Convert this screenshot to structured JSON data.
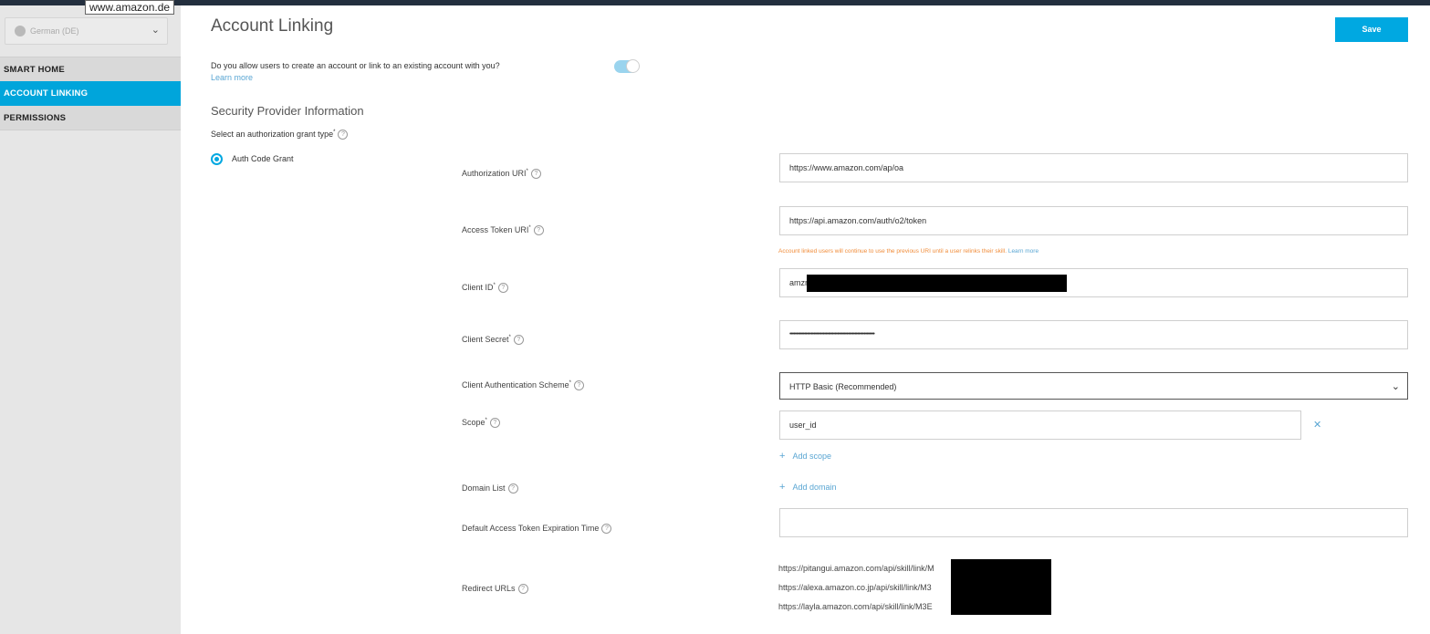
{
  "tooltip": "www.amazon.de",
  "sidebar": {
    "locale": "German (DE)",
    "items": [
      {
        "label": "SMART HOME"
      },
      {
        "label": "ACCOUNT LINKING"
      },
      {
        "label": "PERMISSIONS"
      }
    ]
  },
  "page": {
    "title": "Account Linking",
    "save_label": "Save",
    "question": "Do you allow users to create an account or link to an existing account with you?",
    "learn_more": "Learn more",
    "toggle_on": true,
    "section_title": "Security Provider Information",
    "grant_type_label": "Select an authorization grant type",
    "grant_option": "Auth Code Grant"
  },
  "form": {
    "authorization_uri": {
      "label": "Authorization URI",
      "value": "https://www.amazon.com/ap/oa"
    },
    "access_token_uri": {
      "label": "Access Token URI",
      "value": "https://api.amazon.com/auth/o2/token"
    },
    "access_note": "Account linked users will continue to use the previous URI until a user relinks their skill.",
    "access_note_link": "Learn more",
    "client_id": {
      "label": "Client ID",
      "value": "amzn"
    },
    "client_secret": {
      "label": "Client Secret",
      "value": "••••••••••••••••••••••••••••••••••••••••••••••••••••••••••••••••"
    },
    "client_auth_scheme": {
      "label": "Client Authentication Scheme",
      "value": "HTTP Basic (Recommended)"
    },
    "scope": {
      "label": "Scope",
      "value": "user_id"
    },
    "add_scope": "Add scope",
    "domain_list": {
      "label": "Domain List"
    },
    "add_domain": "Add domain",
    "expiration": {
      "label": "Default Access Token Expiration Time",
      "value": ""
    },
    "redirect": {
      "label": "Redirect URLs",
      "urls": [
        "https://pitangui.amazon.com/api/skill/link/M",
        "https://alexa.amazon.co.jp/api/skill/link/M3",
        "https://layla.amazon.com/api/skill/link/M3E"
      ]
    }
  }
}
